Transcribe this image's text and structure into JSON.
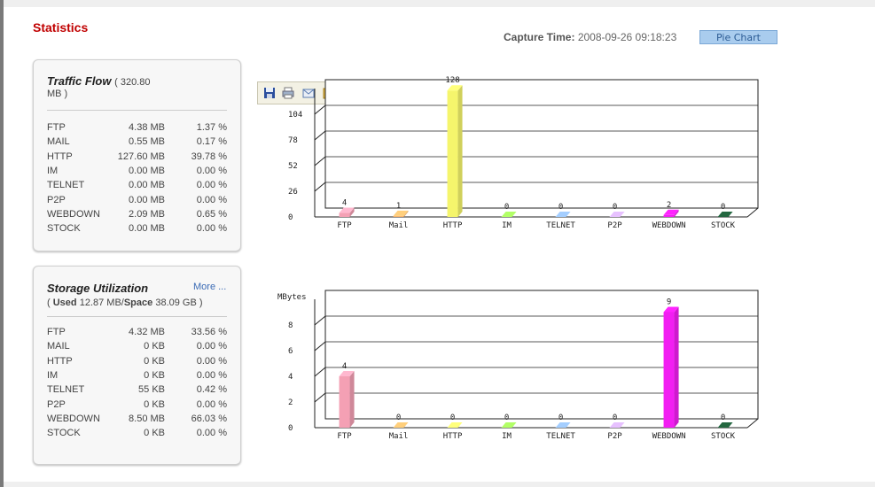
{
  "header": {
    "title": "Statistics",
    "capture_label": "Capture Time:",
    "capture_value": "2008-09-26 09:18:23",
    "pie_chart_button": "Pie Chart"
  },
  "traffic_panel": {
    "title": "Traffic Flow",
    "total": "( 320.80",
    "total_cont": "MB )",
    "rows": [
      {
        "name": "FTP",
        "size": "4.38 MB",
        "pct": "1.37 %"
      },
      {
        "name": "MAIL",
        "size": "0.55 MB",
        "pct": "0.17 %"
      },
      {
        "name": "HTTP",
        "size": "127.60 MB",
        "pct": "39.78 %"
      },
      {
        "name": "IM",
        "size": "0.00 MB",
        "pct": "0.00 %"
      },
      {
        "name": "TELNET",
        "size": "0.00 MB",
        "pct": "0.00 %"
      },
      {
        "name": "P2P",
        "size": "0.00 MB",
        "pct": "0.00 %"
      },
      {
        "name": "WEBDOWN",
        "size": "2.09 MB",
        "pct": "0.65 %"
      },
      {
        "name": "STOCK",
        "size": "0.00 MB",
        "pct": "0.00 %"
      }
    ]
  },
  "storage_panel": {
    "title": "Storage Utilization",
    "more_link": "More ...",
    "sub_open": "(",
    "used_label": "Used",
    "used_value": "12.87 MB/",
    "space_label": "Space",
    "space_value": "38.09 GB )",
    "rows": [
      {
        "name": "FTP",
        "size": "4.32 MB",
        "pct": "33.56 %"
      },
      {
        "name": "MAIL",
        "size": "0 KB",
        "pct": "0.00 %"
      },
      {
        "name": "HTTP",
        "size": "0 KB",
        "pct": "0.00 %"
      },
      {
        "name": "IM",
        "size": "0 KB",
        "pct": "0.00 %"
      },
      {
        "name": "TELNET",
        "size": "55 KB",
        "pct": "0.42 %"
      },
      {
        "name": "P2P",
        "size": "0 KB",
        "pct": "0.00 %"
      },
      {
        "name": "WEBDOWN",
        "size": "8.50 MB",
        "pct": "66.03 %"
      },
      {
        "name": "STOCK",
        "size": "0 KB",
        "pct": "0.00 %"
      }
    ]
  },
  "toolbar": {
    "icons": [
      "save-icon",
      "print-icon",
      "email-icon",
      "export-icon"
    ]
  },
  "colors": {
    "FTP": "#f4a0b4",
    "Mail": "#f7b46c",
    "HTTP": "#f5f56c",
    "IM": "#9be05a",
    "TELNET": "#8fb3e0",
    "P2P": "#c9a8f0",
    "WEBDOWN": "#f21ef2",
    "STOCK": "#1f5a38"
  },
  "chart_data": [
    {
      "type": "bar",
      "categories": [
        "FTP",
        "Mail",
        "HTTP",
        "IM",
        "TELNET",
        "P2P",
        "WEBDOWN",
        "STOCK"
      ],
      "values": [
        4,
        1,
        128,
        0,
        0,
        0,
        2,
        0
      ],
      "ylabel": "",
      "yticks": [
        0,
        26,
        52,
        78,
        104
      ],
      "ylim": [
        0,
        130
      ],
      "grid": true
    },
    {
      "type": "bar",
      "categories": [
        "FTP",
        "Mail",
        "HTTP",
        "IM",
        "TELNET",
        "P2P",
        "WEBDOWN",
        "STOCK"
      ],
      "values": [
        4,
        0,
        0,
        0,
        0,
        0,
        9,
        0
      ],
      "ylabel": "MBytes",
      "yticks": [
        0,
        2,
        4,
        6,
        8
      ],
      "ylim": [
        0,
        10
      ],
      "grid": true
    }
  ]
}
